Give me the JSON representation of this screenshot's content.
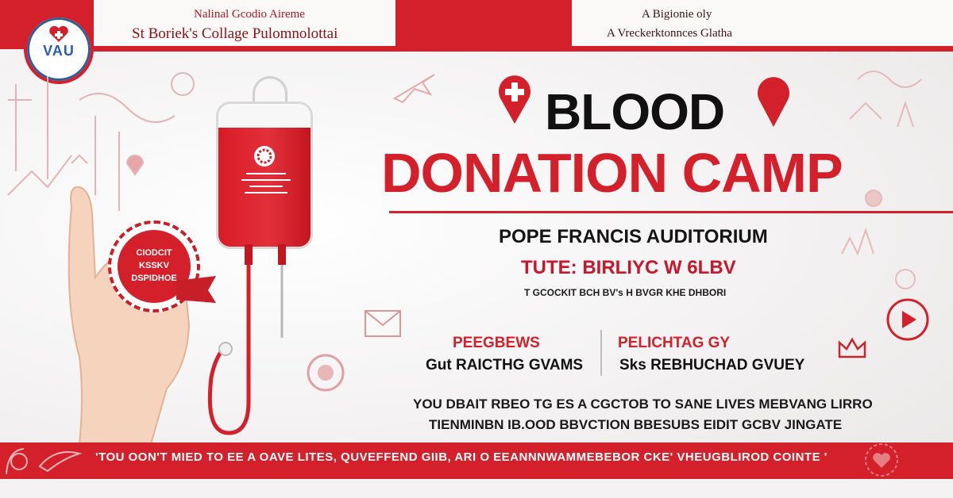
{
  "header": {
    "left_line1": "Nalinal Gcodio Aireme",
    "left_line2": "St Boriek's Collage Pulomnolottai",
    "right_line1": "A Bigionie oly",
    "right_line2": "A Vreckerktonnces Glatha"
  },
  "logo": {
    "text": "VAU",
    "icon": "blood-drop-heart-logo"
  },
  "seal": {
    "line1": "CIODCIT",
    "line2": "KSSKV",
    "line3": "DSPIDHOE"
  },
  "title": {
    "line1": "BLOOD",
    "line2": "DONATION CAMP"
  },
  "venue": "POPE FRANCIS AUDITORIUM",
  "date": "TUTE: BIRLIYC W 6LBV",
  "subline": "T GCOCKIT BCH  BV's H BVGR KHE DHBORI",
  "organisers": {
    "left_heading": "PEEGBEWS",
    "left_value": "Gut RAICTHG GVAMS",
    "right_heading": "PELICHTAG GY",
    "right_value": "Sks REBHUCHAD GVUEY"
  },
  "slogan": {
    "line1": "YOU DBAIT RBEO TG ES A CGCTOB TO SANE LIVES MEBVANG LIRRO",
    "line2": "TIENMINBN IB.OOD  BBVCTION BBESUBS EIDIT GCBV JINGATE"
  },
  "footer": {
    "text": "'TOU OON'T MIED TO EE A OAVE LITES, QUVEFFEND GIIB, ARI O EEANNNWAMMEBEBOR CKE' VHEUGBLIROD COINTE '"
  },
  "icons": [
    "plus-location-icon",
    "drop-location-icon",
    "envelope-icon",
    "play-button-icon",
    "crown-icon",
    "heart-icon",
    "airplane-icon",
    "flower-icon"
  ],
  "colors": {
    "brand_red": "#d3202a",
    "dark_text": "#111111"
  }
}
